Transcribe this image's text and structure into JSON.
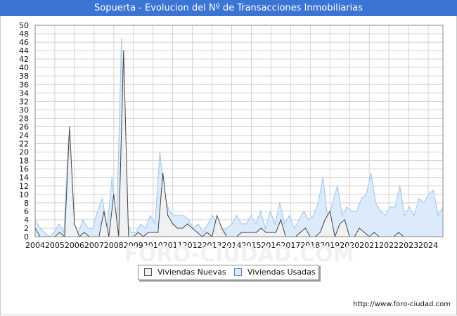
{
  "header": {
    "title": "Sopuerta - Evolucion del Nº de Transacciones Inmobiliarias"
  },
  "footer": {
    "url": "http://www.foro-ciudad.com"
  },
  "watermark": "FORO-CIUDAD.COM",
  "colors": {
    "title_bg": "#3a74d4",
    "nuevas_fill": "#f2f2f2",
    "nuevas_line": "#444444",
    "usadas_fill": "#dcebfb",
    "usadas_line": "#9cc4ee",
    "grid": "#d2d2d2"
  },
  "chart_data": {
    "type": "area",
    "title": "Sopuerta - Evolucion del Nº de Transacciones Inmobiliarias",
    "xlabel": "",
    "ylabel": "",
    "ylim": [
      0,
      50
    ],
    "yticks": [
      0,
      2,
      4,
      6,
      8,
      10,
      12,
      14,
      16,
      18,
      20,
      22,
      24,
      26,
      28,
      30,
      32,
      34,
      36,
      38,
      40,
      42,
      44,
      46,
      48,
      50
    ],
    "xlim": [
      2004,
      2024.75
    ],
    "xticks": [
      "2004",
      "2005",
      "2006",
      "2007",
      "2008",
      "2009",
      "2010",
      "2011",
      "2012",
      "2013",
      "2014",
      "2015",
      "2016",
      "2017",
      "2018",
      "2019",
      "2020",
      "2021",
      "2022",
      "2023",
      "2024"
    ],
    "x_quarters": [
      "2004-Q1",
      "2004-Q2",
      "2004-Q3",
      "2004-Q4",
      "2005-Q1",
      "2005-Q2",
      "2005-Q3",
      "2005-Q4",
      "2006-Q1",
      "2006-Q2",
      "2006-Q3",
      "2006-Q4",
      "2007-Q1",
      "2007-Q2",
      "2007-Q3",
      "2007-Q4",
      "2008-Q1",
      "2008-Q2",
      "2008-Q3",
      "2008-Q4",
      "2009-Q1",
      "2009-Q2",
      "2009-Q3",
      "2009-Q4",
      "2010-Q1",
      "2010-Q2",
      "2010-Q3",
      "2010-Q4",
      "2011-Q1",
      "2011-Q2",
      "2011-Q3",
      "2011-Q4",
      "2012-Q1",
      "2012-Q2",
      "2012-Q3",
      "2012-Q4",
      "2013-Q1",
      "2013-Q2",
      "2013-Q3",
      "2013-Q4",
      "2014-Q1",
      "2014-Q2",
      "2014-Q3",
      "2014-Q4",
      "2015-Q1",
      "2015-Q2",
      "2015-Q3",
      "2015-Q4",
      "2016-Q1",
      "2016-Q2",
      "2016-Q3",
      "2016-Q4",
      "2017-Q1",
      "2017-Q2",
      "2017-Q3",
      "2017-Q4",
      "2018-Q1",
      "2018-Q2",
      "2018-Q3",
      "2018-Q4",
      "2019-Q1",
      "2019-Q2",
      "2019-Q3",
      "2019-Q4",
      "2020-Q1",
      "2020-Q2",
      "2020-Q3",
      "2020-Q4",
      "2021-Q1",
      "2021-Q2",
      "2021-Q3",
      "2021-Q4",
      "2022-Q1",
      "2022-Q2",
      "2022-Q3",
      "2022-Q4",
      "2023-Q1",
      "2023-Q2",
      "2023-Q3",
      "2023-Q4",
      "2024-Q1",
      "2024-Q2",
      "2024-Q3",
      "2024-Q4"
    ],
    "legend_position": "bottom-center",
    "grid": true,
    "series": [
      {
        "name": "Viviendas Nuevas",
        "values": [
          2,
          0,
          0,
          0,
          0,
          1,
          0,
          26,
          3,
          0,
          1,
          0,
          0,
          0,
          6,
          0,
          10,
          0,
          44,
          0,
          0,
          1,
          0,
          1,
          1,
          1,
          15,
          5,
          3,
          2,
          2,
          3,
          2,
          1,
          0,
          1,
          0,
          5,
          2,
          0,
          0,
          0,
          1,
          1,
          1,
          1,
          2,
          1,
          1,
          1,
          4,
          0,
          0,
          0,
          1,
          2,
          0,
          0,
          1,
          4,
          6,
          0,
          3,
          4,
          0,
          0,
          2,
          1,
          0,
          1,
          0,
          0,
          0,
          0,
          1,
          0,
          0,
          0,
          0,
          0,
          0,
          0,
          0,
          0
        ]
      },
      {
        "name": "Viviendas Usadas",
        "values": [
          4,
          2,
          1,
          0,
          1,
          3,
          1,
          24,
          3,
          1,
          4,
          2,
          2,
          6,
          9,
          2,
          14,
          3,
          47,
          4,
          1,
          1,
          3,
          2,
          5,
          3,
          20,
          9,
          6,
          5,
          5,
          5,
          4,
          2,
          3,
          1,
          3,
          5,
          3,
          1,
          2,
          3,
          5,
          3,
          3,
          5,
          3,
          6,
          2,
          6,
          3,
          8,
          3,
          5,
          2,
          4,
          6,
          4,
          5,
          8,
          14,
          4,
          8,
          12,
          5,
          7,
          6,
          6,
          9,
          10,
          15,
          8,
          6,
          5,
          7,
          7,
          12,
          5,
          7,
          5,
          9,
          8,
          10,
          11,
          5,
          7
        ]
      }
    ]
  },
  "legend": {
    "items": [
      {
        "label": "Viviendas Nuevas"
      },
      {
        "label": "Viviendas Usadas"
      }
    ]
  }
}
